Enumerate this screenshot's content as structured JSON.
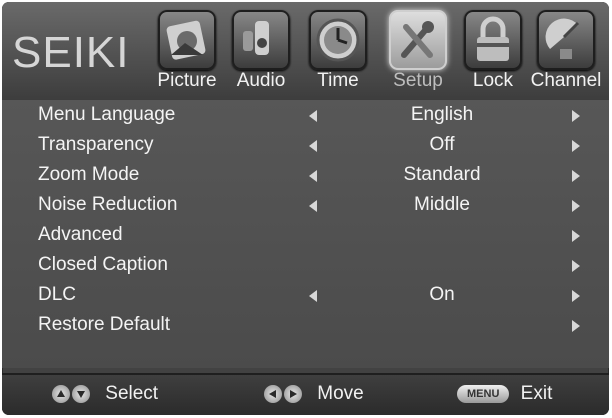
{
  "brand": "SEIKI",
  "tabs": [
    {
      "label": "Picture",
      "icon": "picture-icon"
    },
    {
      "label": "Audio",
      "icon": "audio-icon"
    },
    {
      "label": "Time",
      "icon": "time-icon"
    },
    {
      "label": "Setup",
      "icon": "setup-icon",
      "active": true
    },
    {
      "label": "Lock",
      "icon": "lock-icon"
    },
    {
      "label": "Channel",
      "icon": "channel-icon"
    }
  ],
  "menu": {
    "items": [
      {
        "label": "Menu Language",
        "value": "English",
        "has_left_arrow": true,
        "has_right_arrow": true
      },
      {
        "label": "Transparency",
        "value": "Off",
        "has_left_arrow": true,
        "has_right_arrow": true
      },
      {
        "label": "Zoom Mode",
        "value": "Standard",
        "has_left_arrow": true,
        "has_right_arrow": true
      },
      {
        "label": "Noise Reduction",
        "value": "Middle",
        "has_left_arrow": true,
        "has_right_arrow": true
      },
      {
        "label": "Advanced",
        "value": "",
        "has_left_arrow": false,
        "has_right_arrow": true
      },
      {
        "label": "Closed Caption",
        "value": "",
        "has_left_arrow": false,
        "has_right_arrow": true
      },
      {
        "label": "DLC",
        "value": "On",
        "has_left_arrow": true,
        "has_right_arrow": true
      },
      {
        "label": "Restore Default",
        "value": "",
        "has_left_arrow": false,
        "has_right_arrow": true
      }
    ]
  },
  "footer": {
    "select_label": "Select",
    "move_label": "Move",
    "menu_button_text": "MENU",
    "exit_label": "Exit"
  },
  "colors": {
    "background": "#4f4f4f",
    "text": "#f4f4f4",
    "active_tab_label": "#bdbdbd"
  }
}
